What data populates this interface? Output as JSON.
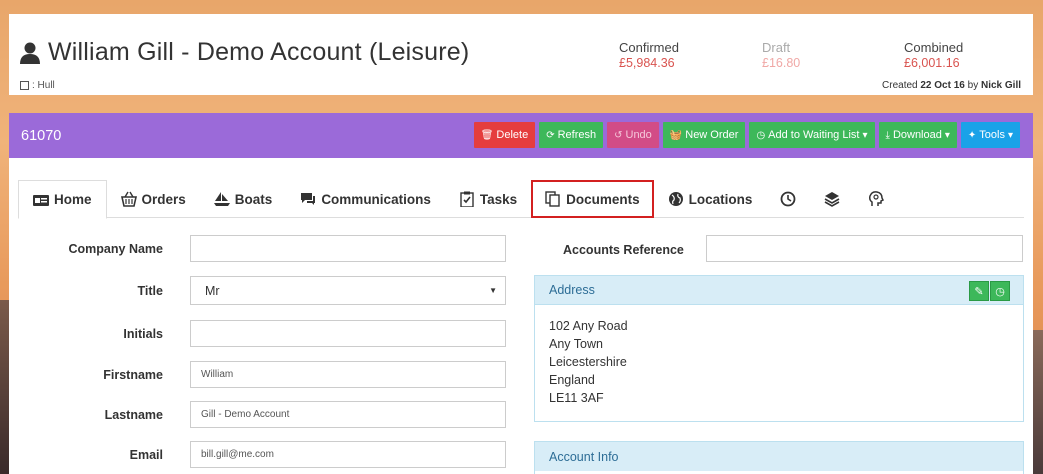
{
  "header": {
    "customer_name": "William Gill - Demo Account (Leisure)",
    "location": ": Hull",
    "confirmed_label": "Confirmed",
    "confirmed_value": "£5,984.36",
    "draft_label": "Draft",
    "draft_value": "£16.80",
    "combined_label": "Combined",
    "combined_value": "£6,001.16",
    "created_prefix": "Created",
    "created_date": "22 Oct 16",
    "created_by_prefix": "by",
    "created_by": "Nick Gill"
  },
  "panel": {
    "id": "61070",
    "buttons": {
      "delete": "Delete",
      "refresh": "Refresh",
      "undo": "Undo",
      "new_order": "New Order",
      "waiting_list": "Add to Waiting List",
      "download": "Download",
      "tools": "Tools"
    }
  },
  "tabs": [
    {
      "label": "Home"
    },
    {
      "label": "Orders"
    },
    {
      "label": "Boats"
    },
    {
      "label": "Communications"
    },
    {
      "label": "Tasks"
    },
    {
      "label": "Documents"
    },
    {
      "label": "Locations"
    }
  ],
  "form": {
    "company_name_label": "Company Name",
    "company_name_value": "",
    "title_label": "Title",
    "title_value": "Mr",
    "initials_label": "Initials",
    "initials_value": "",
    "firstname_label": "Firstname",
    "firstname_value": "William",
    "lastname_label": "Lastname",
    "lastname_value": "Gill - Demo Account",
    "email_label": "Email",
    "email_value": "bill.gill@me.com",
    "email_addon": "@",
    "accounts_ref_label": "Accounts Reference",
    "accounts_ref_value": ""
  },
  "address": {
    "heading": "Address",
    "line1": "102 Any Road",
    "line2": "Any Town",
    "line3": "Leicestershire",
    "line4": "England",
    "line5": "LE11 3AF"
  },
  "account_info": {
    "heading": "Account Info"
  },
  "colors": {
    "purple_bar": "#9b6ad9",
    "delete_btn": "#e53d3d",
    "green_btn": "#3db85a",
    "undo_btn": "#d24c86",
    "tools_btn": "#1aa2e8",
    "money_red": "#d9534f",
    "highlight_box": "#d32020"
  }
}
